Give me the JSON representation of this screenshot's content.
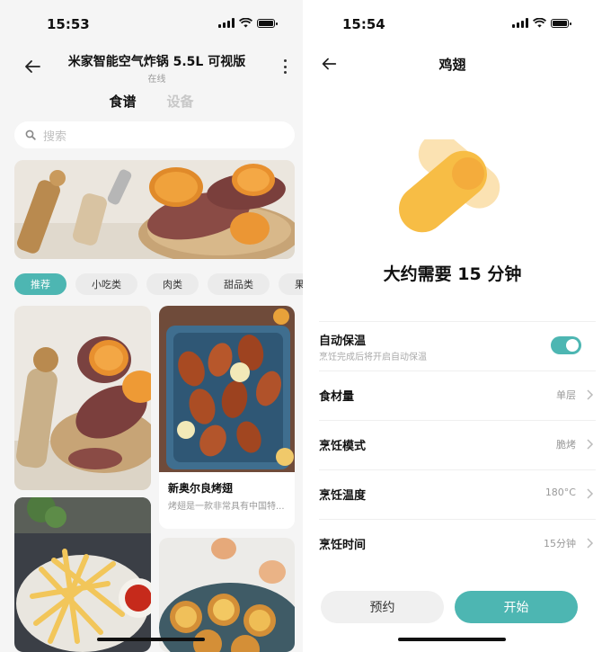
{
  "left": {
    "status": {
      "time": "15:53"
    },
    "header": {
      "title": "米家智能空气炸锅 5.5L 可视版",
      "subtitle": "在线"
    },
    "tabs": [
      {
        "label": "食谱",
        "active": true
      },
      {
        "label": "设备",
        "active": false
      }
    ],
    "search": {
      "placeholder": "搜索"
    },
    "chips": [
      {
        "label": "推荐",
        "active": true
      },
      {
        "label": "小吃类",
        "active": false
      },
      {
        "label": "肉类",
        "active": false
      },
      {
        "label": "甜品类",
        "active": false
      },
      {
        "label": "果蔬",
        "active": false
      }
    ],
    "cards": [
      {
        "title": "新奥尔良烤翅",
        "desc": "烤翅是一款非常具有中国特..."
      }
    ]
  },
  "right": {
    "status": {
      "time": "15:54"
    },
    "header": {
      "title": "鸡翅"
    },
    "headline": "大约需要 15 分钟",
    "settings": {
      "keep_warm": {
        "label": "自动保温",
        "desc": "烹饪完成后将开启自动保温",
        "enabled": true
      },
      "ingredient_amount": {
        "label": "食材量",
        "value": "单层"
      },
      "cooking_mode": {
        "label": "烹饪模式",
        "value": "脆烤"
      },
      "temperature": {
        "label": "烹饪温度",
        "value": "180°C"
      },
      "time": {
        "label": "烹饪时间",
        "value": "15分钟"
      }
    },
    "buttons": {
      "reserve": "预约",
      "start": "开始"
    }
  },
  "colors": {
    "accent": "#4db6b2",
    "illustration_primary": "#f7bd45",
    "illustration_secondary": "#fbe2b2"
  }
}
